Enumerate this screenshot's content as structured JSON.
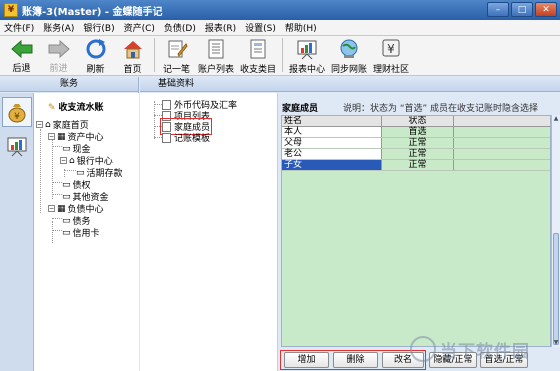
{
  "window": {
    "title": "账簿-3(Master) - 金蝶随手记",
    "app_icon_glyph": "¥",
    "minimize": "–",
    "maximize": "□",
    "close": "✕"
  },
  "menu": [
    "文件(F)",
    "账务(A)",
    "银行(B)",
    "资产(C)",
    "负债(D)",
    "报表(R)",
    "设置(S)",
    "帮助(H)"
  ],
  "toolbar": {
    "back": "后退",
    "forward": "前进",
    "refresh": "刷新",
    "home": "首页",
    "record": "记一笔",
    "account_list": "账户列表",
    "category": "收支类目",
    "report_center": "报表中心",
    "sync": "同步网账",
    "community": "理财社区"
  },
  "left_panel": {
    "header": "账务",
    "tree_title": "收支流水账",
    "tree": {
      "family_home": "家庭首页",
      "assets": "资产中心",
      "cash": "现金",
      "bank": "银行中心",
      "current_deposit": "活期存款",
      "claims": "债权",
      "other_funds": "其他资金",
      "liabilities": "负债中心",
      "debts": "债务",
      "credit_card": "信用卡"
    }
  },
  "content_header": "基础资料",
  "mid_tree": {
    "foreign_currency": "外币代码及汇率",
    "project_list": "项目列表",
    "family_members": "家庭成员",
    "template": "记账模板"
  },
  "right_panel": {
    "title": "家庭成员",
    "note": "说明：状态为 “首选” 成员在收支记账时隐含选择",
    "columns": {
      "name": "姓名",
      "status": "状态"
    },
    "rows": [
      {
        "name": "本人",
        "status": "首选"
      },
      {
        "name": "父母",
        "status": "正常"
      },
      {
        "name": "老公",
        "status": "正常"
      },
      {
        "name": "子女",
        "status": "正常"
      }
    ],
    "selected_row": 3
  },
  "buttons": {
    "add": "增加",
    "delete": "删除",
    "rename": "改名",
    "hide_normal": "隐藏/正常",
    "preferred_normal": "首选/正常"
  },
  "watermark": "当下软件园",
  "colors": {
    "grid_background": "#c9eac9",
    "selection": "#2a5ab8",
    "highlight_box": "#e03030"
  }
}
